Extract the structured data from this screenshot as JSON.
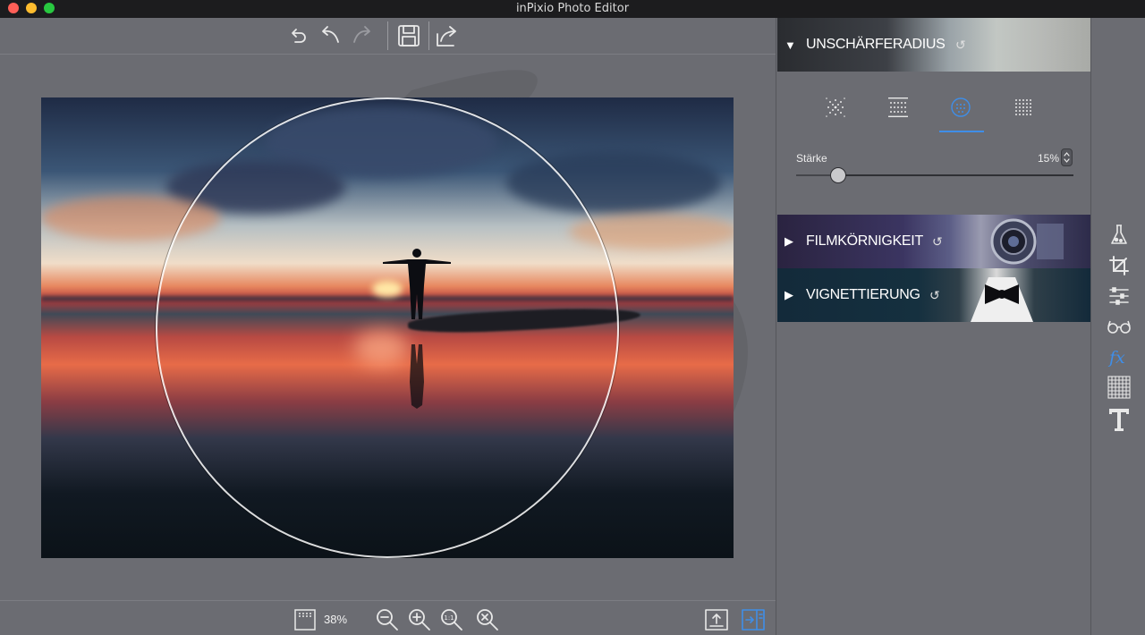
{
  "window": {
    "title": "inPixio Photo Editor"
  },
  "toolbar": {
    "icons": [
      "undo-all-icon",
      "undo-icon",
      "redo-icon",
      "save-icon",
      "share-icon"
    ]
  },
  "bottom_bar": {
    "zoom_level": "38%",
    "icons": [
      "fit-frame-icon",
      "zoom-out-icon",
      "zoom-in-icon",
      "actual-size-icon",
      "zoom-fit-icon",
      "export-icon",
      "panel-toggle-icon"
    ]
  },
  "panel": {
    "blur_section": {
      "title": "UNSCHÄRFERADIUS",
      "expanded": true,
      "blur_types": [
        "radial-blur-icon",
        "linear-blur-icon",
        "circle-blur-icon",
        "dotted-blur-icon"
      ],
      "selected_blur_type": "circle-blur-icon",
      "strength": {
        "label": "Stärke",
        "value_text": "15%",
        "value": 0.15
      }
    },
    "film_section": {
      "title": "FILMKÖRNIGKEIT",
      "expanded": false
    },
    "vignette_section": {
      "title": "VIGNETTIERUNG",
      "expanded": false
    }
  },
  "rail": {
    "tools": [
      "effects-flask-icon",
      "crop-icon",
      "adjust-sliders-icon",
      "glasses-icon",
      "fx-icon",
      "texture-icon",
      "text-icon"
    ],
    "active_tool": "fx-icon"
  },
  "colors": {
    "accent": "#3f8ee8",
    "background": "#6b6c72",
    "titlebar": "#1c1c1e"
  }
}
